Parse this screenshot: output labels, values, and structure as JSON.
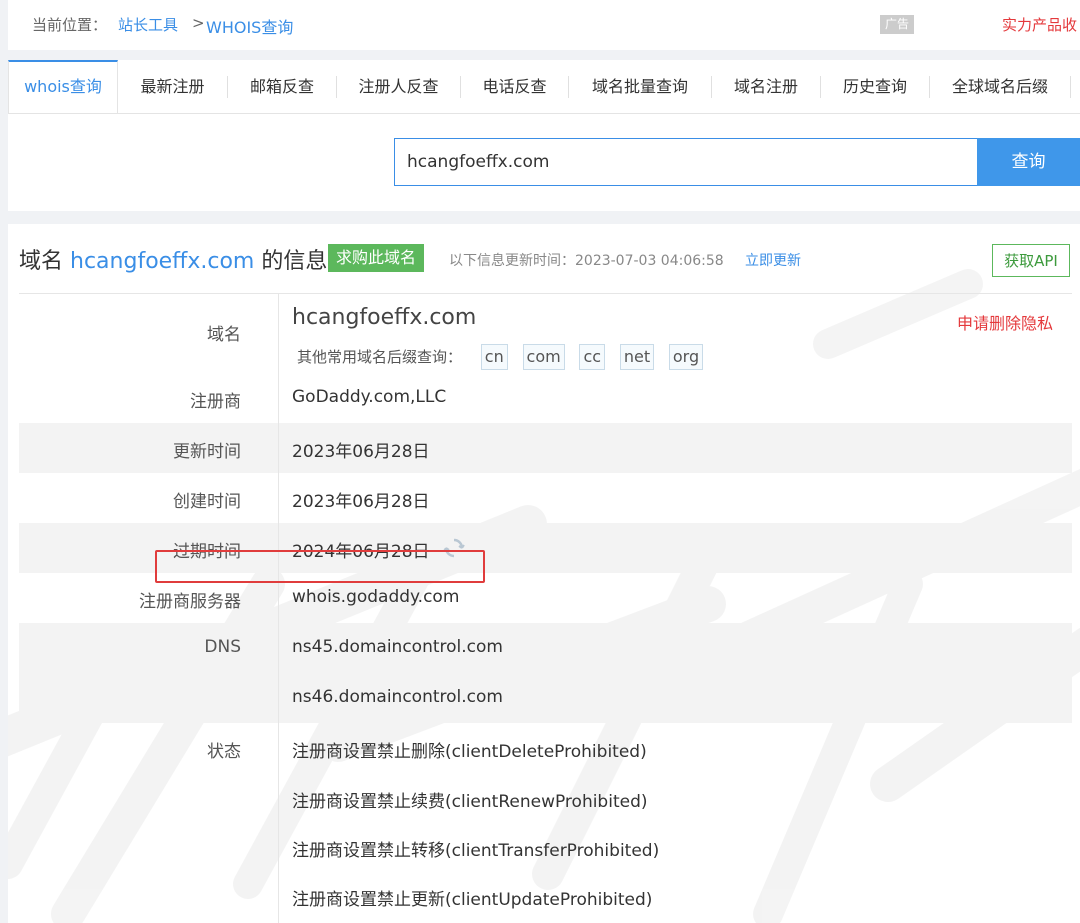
{
  "breadcrumb": {
    "label": "当前位置：",
    "link1": "站长工具",
    "sep": ">",
    "link2": "WHOIS查询"
  },
  "ad": {
    "tag": "广告",
    "text": "实力产品收"
  },
  "tabs": [
    {
      "label": "whois查询",
      "active": true
    },
    {
      "label": "最新注册"
    },
    {
      "label": "邮箱反查"
    },
    {
      "label": "注册人反查"
    },
    {
      "label": "电话反查"
    },
    {
      "label": "域名批量查询"
    },
    {
      "label": "域名注册"
    },
    {
      "label": "历史查询"
    },
    {
      "label": "全球域名后缀"
    }
  ],
  "search": {
    "value": "hcangfoeffx.com",
    "button": "查询"
  },
  "info": {
    "title_prefix": "域名",
    "title_domain": "hcangfoeffx.com",
    "title_suffix": "的信息",
    "buy_badge": "求购此域名",
    "update_label": "以下信息更新时间：2023-07-03 04:06:58",
    "update_link": "立即更新",
    "api_button": "获取API"
  },
  "record": {
    "domain_label": "域名",
    "domain_value": "hcangfoeffx.com",
    "delete_privacy": "申请删除隐私",
    "suffix_label": "其他常用域名后缀查询：",
    "suffixes": [
      "cn",
      "com",
      "cc",
      "net",
      "org"
    ],
    "registrar_label": "注册商",
    "registrar_value": "GoDaddy.com,LLC",
    "updated_label": "更新时间",
    "updated_value": "2023年06月28日",
    "created_label": "创建时间",
    "created_value": "2023年06月28日",
    "expires_label": "过期时间",
    "expires_value": "2024年06月28日",
    "server_label": "注册商服务器",
    "server_value": "whois.godaddy.com",
    "dns_label": "DNS",
    "dns": [
      "ns45.domaincontrol.com",
      "ns46.domaincontrol.com"
    ],
    "status_label": "状态",
    "status": [
      "注册商设置禁止删除(clientDeleteProhibited)",
      "注册商设置禁止续费(clientRenewProhibited)",
      "注册商设置禁止转移(clientTransferProhibited)",
      "注册商设置禁止更新(clientUpdateProhibited)"
    ]
  },
  "colors": {
    "link": "#3a8ee6",
    "button": "#3f97ea",
    "badge": "#5cb85c",
    "danger": "#e4393c",
    "highlight": "#e03c3c"
  },
  "icons": {
    "refresh": "refresh-icon"
  }
}
